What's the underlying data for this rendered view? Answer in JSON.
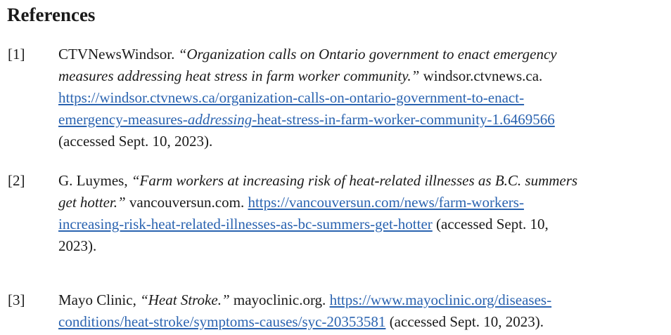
{
  "heading": "References",
  "references": [
    {
      "number": "[1]",
      "lines": [
        {
          "author": "CTVNewsWindsor. ",
          "title": "“Organization calls on Ontario government to enact emergency"
        },
        {
          "title": "measures addressing heat stress in farm worker community.”",
          "site": " windsor.ctvnews.ca."
        },
        {
          "url": "https://windsor.ctvnews.ca/organization-calls-on-ontario-government-to-enact-"
        },
        {
          "url_a": "emergency-measures-",
          "url_b": "addressing",
          "url_c": "-heat-stress-in-farm-worker-community-1.6469566"
        },
        {
          "accessed": "(accessed Sept. 10, 2023)."
        }
      ]
    },
    {
      "number": "[2]",
      "lines": [
        {
          "author": "G. Luymes, ",
          "title": "“Farm workers at increasing risk of heat-related illnesses as B.C. summers"
        },
        {
          "title": "get hotter.”",
          "site": " vancouversun.com. ",
          "url": "https://vancouversun.com/news/farm-workers-"
        },
        {
          "url": "increasing-risk-heat-related-illnesses-as-bc-summers-get-hotter",
          "accessed": " (accessed Sept. 10,"
        },
        {
          "accessed": "2023)."
        }
      ]
    },
    {
      "number": "[3]",
      "lines": [
        {
          "author": "Mayo Clinic, ",
          "title": "“Heat Stroke.”",
          "site": " mayoclinic.org. ",
          "url": "https://www.mayoclinic.org/diseases-"
        },
        {
          "url": "conditions/heat-stroke/symptoms-causes/syc-20353581",
          "accessed": " (accessed Sept. 10, 2023)."
        }
      ]
    }
  ]
}
